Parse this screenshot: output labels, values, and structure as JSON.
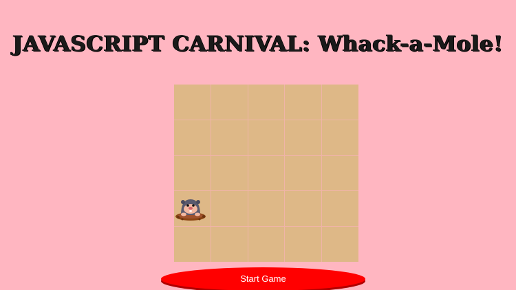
{
  "title": "JAVASCRIPT CARNIVAL: Whack-a-Mole!",
  "board": {
    "rows": 5,
    "cols": 5,
    "mole_position": {
      "row": 4,
      "col": 1
    }
  },
  "start_button": {
    "label": "Start Game"
  },
  "colors": {
    "background": "#ffb6c1",
    "board": "#deb887",
    "button": "#ff0000"
  }
}
